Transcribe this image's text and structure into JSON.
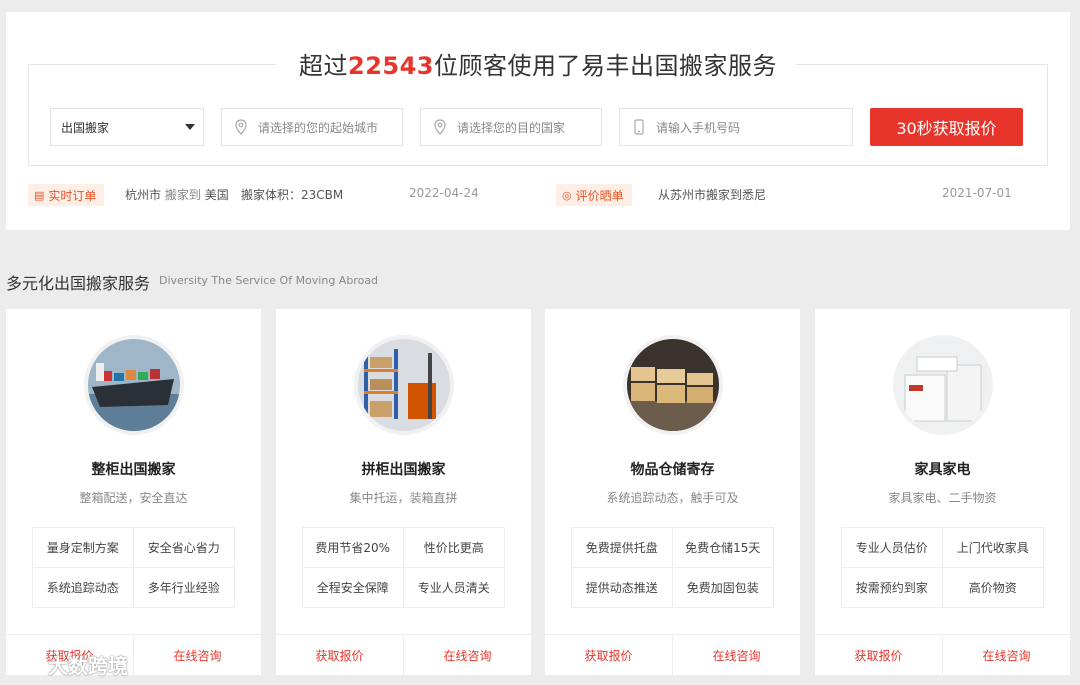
{
  "hero": {
    "title_pre": "超过",
    "customer_count": "22543",
    "title_post": "位顾客使用了易丰出国搬家服务"
  },
  "search": {
    "service_select": "出国搬家",
    "start_city_placeholder": "请选择的您的起始城市",
    "dest_country_placeholder": "请选择您的目的国家",
    "phone_placeholder": "请输入手机号码",
    "submit_label": "30秒获取报价"
  },
  "live_order": {
    "tag": "实时订单",
    "from_city": "杭州市",
    "moved_to": "搬家到",
    "to_country": "美国",
    "volume": "搬家体积：23CBM",
    "date": "2022-04-24"
  },
  "review": {
    "tag": "评价晒单",
    "text": "从苏州市搬家到悉尼",
    "date": "2021-07-01"
  },
  "section": {
    "title": "多元化出国搬家服务",
    "subtitle": "Diversity The Service Of Moving Abroad"
  },
  "services": [
    {
      "title": "整柜出国搬家",
      "subtitle": "整箱配送，安全直达",
      "features": [
        "量身定制方案",
        "安全省心省力",
        "系统追踪动态",
        "多年行业经验"
      ],
      "quote": "获取报价",
      "consult": "在线咨询"
    },
    {
      "title": "拼柜出国搬家",
      "subtitle": "集中托运，装箱直拼",
      "features": [
        "费用节省20%",
        "性价比更高",
        "全程安全保障",
        "专业人员清关"
      ],
      "quote": "获取报价",
      "consult": "在线咨询"
    },
    {
      "title": "物品仓储寄存",
      "subtitle": "系统追踪动态，触手可及",
      "features": [
        "免费提供托盘",
        "免费仓储15天",
        "提供动态推送",
        "免费加固包装"
      ],
      "quote": "获取报价",
      "consult": "在线咨询"
    },
    {
      "title": "家具家电",
      "subtitle": "家具家电、二手物资",
      "features": [
        "专业人员估价",
        "上门代收家具",
        "按需预约到家",
        "高价物资"
      ],
      "quote": "获取报价",
      "consult": "在线咨询"
    }
  ],
  "watermark": "大数跨境"
}
